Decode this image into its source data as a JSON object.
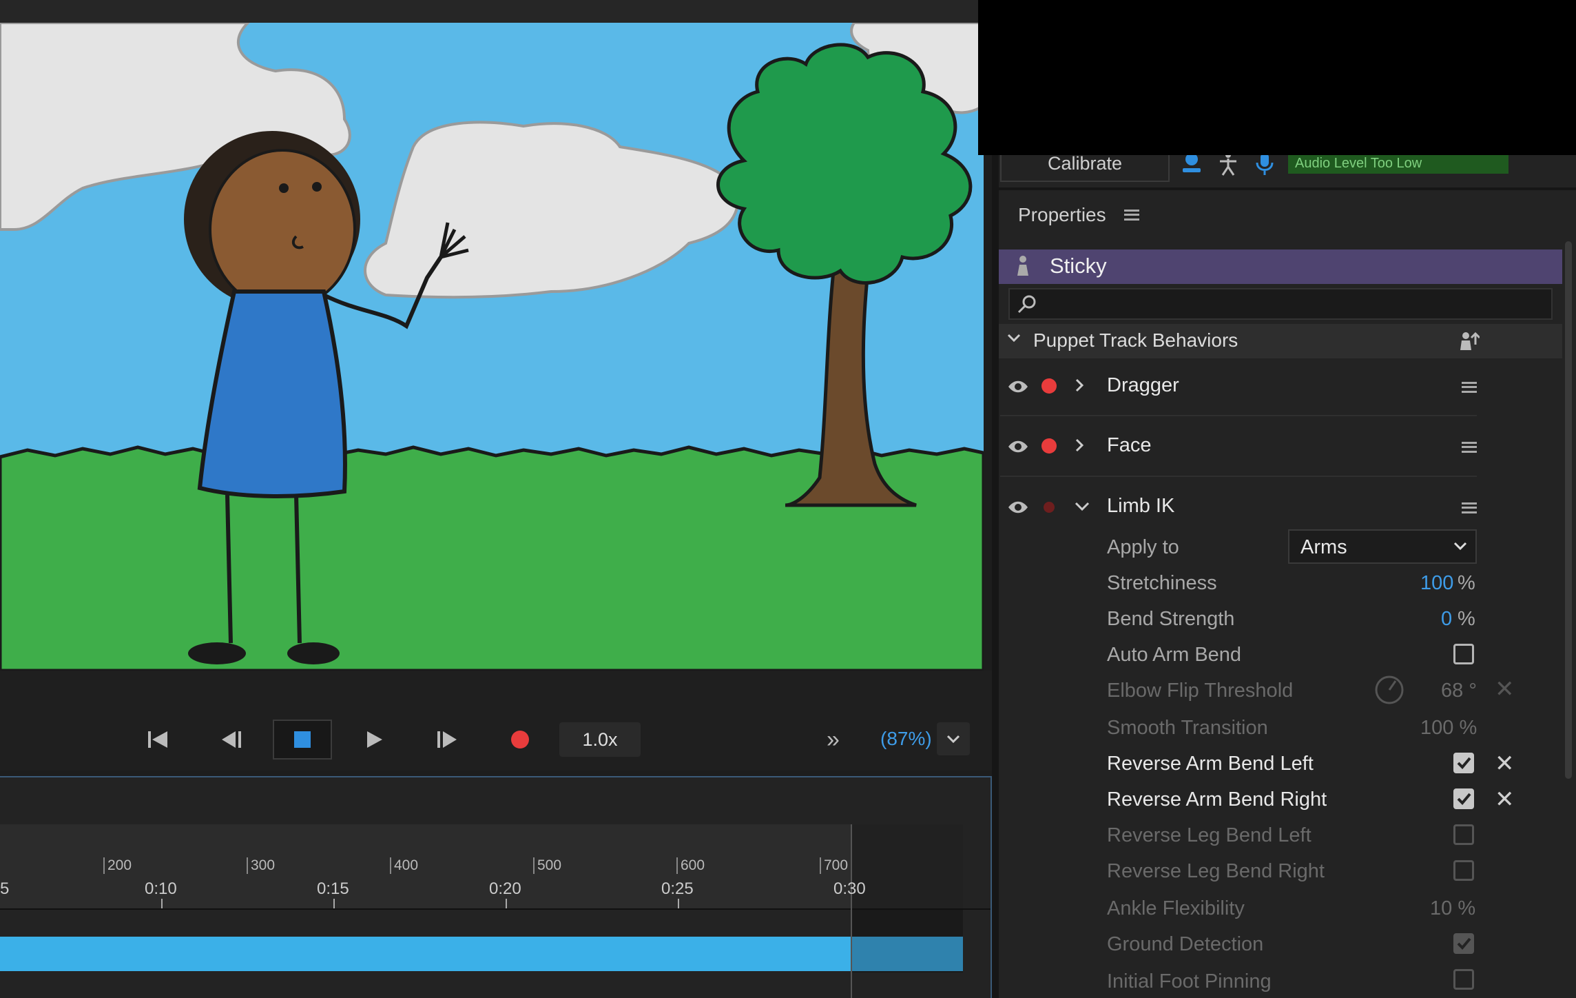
{
  "toolbar": {
    "calibrate_label": "Calibrate",
    "audio_status": "Audio Level Too Low",
    "icons": [
      "webcam-icon",
      "body-tracker-icon",
      "microphone-icon"
    ]
  },
  "properties": {
    "title": "Properties",
    "puppet_name": "Sticky",
    "search_placeholder": "",
    "section_title": "Puppet Track Behaviors",
    "behaviors": [
      {
        "name": "Dragger",
        "expanded": false,
        "armed": true
      },
      {
        "name": "Face",
        "expanded": false,
        "armed": true
      },
      {
        "name": "Limb IK",
        "expanded": true,
        "armed": false
      }
    ],
    "limb_ik": {
      "apply_to_label": "Apply to",
      "apply_to_value": "Arms",
      "stretchiness_label": "Stretchiness",
      "stretchiness_value": "100",
      "bend_strength_label": "Bend Strength",
      "bend_strength_value": "0",
      "percent": "%",
      "auto_arm_bend_label": "Auto Arm Bend",
      "auto_arm_bend": false,
      "elbow_flip_label": "Elbow Flip Threshold",
      "elbow_flip_value": "68 °",
      "smooth_transition_label": "Smooth Transition",
      "smooth_transition_value": "100 %",
      "reverse_arm_left_label": "Reverse Arm Bend Left",
      "reverse_arm_left": true,
      "reverse_arm_right_label": "Reverse Arm Bend Right",
      "reverse_arm_right": true,
      "reverse_leg_left_label": "Reverse Leg Bend Left",
      "reverse_leg_left": false,
      "reverse_leg_right_label": "Reverse Leg Bend Right",
      "reverse_leg_right": false,
      "ankle_flex_label": "Ankle Flexibility",
      "ankle_flex_value": "10 %",
      "ground_detection_label": "Ground Detection",
      "ground_detection": true,
      "initial_foot_label": "Initial Foot Pinning",
      "initial_foot": false
    }
  },
  "transport": {
    "speed": "1.0x",
    "zoom": "(87%)",
    "more": "»"
  },
  "timeline": {
    "frame_ticks": [
      "200",
      "300",
      "400",
      "500",
      "600",
      "700"
    ],
    "time_ticks": [
      "0:10",
      "0:15",
      "0:20",
      "0:25",
      "0:30"
    ],
    "partial_left": "5"
  },
  "colors": {
    "sky": "#5ab9e8",
    "grass": "#3fae4a",
    "accent_blue": "#3e9ce8",
    "record_red": "#e83c3c",
    "puppet_header": "#4f4470",
    "audio_bar": "#1f5a1f"
  }
}
